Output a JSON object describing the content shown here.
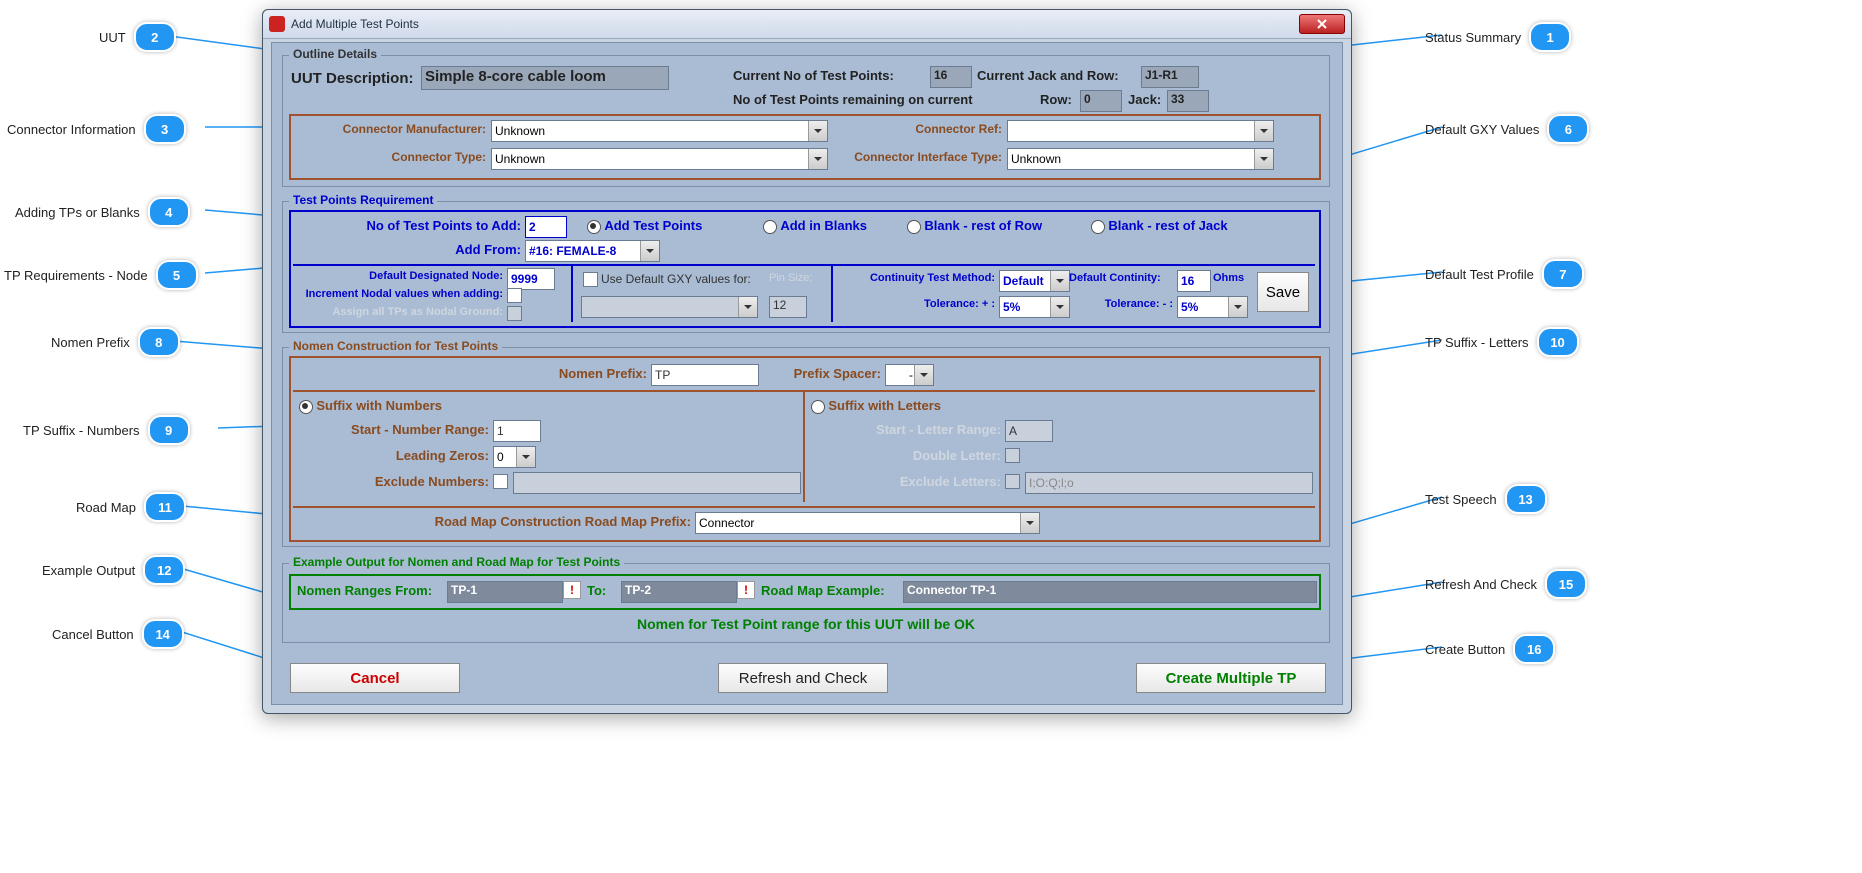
{
  "callouts": {
    "c1": {
      "n": "1",
      "label": "Status Summary"
    },
    "c2": {
      "n": "2",
      "label": "UUT"
    },
    "c3": {
      "n": "3",
      "label": "Connector Information"
    },
    "c4": {
      "n": "4",
      "label": "Adding TPs or Blanks"
    },
    "c5": {
      "n": "5",
      "label": "TP Requirements - Node"
    },
    "c6": {
      "n": "6",
      "label": "Default GXY Values"
    },
    "c7": {
      "n": "7",
      "label": "Default Test Profile"
    },
    "c8": {
      "n": "8",
      "label": "Nomen Prefix"
    },
    "c9": {
      "n": "9",
      "label": "TP Suffix - Numbers"
    },
    "c10": {
      "n": "10",
      "label": "TP Suffix - Letters"
    },
    "c11": {
      "n": "11",
      "label": "Road Map"
    },
    "c12": {
      "n": "12",
      "label": "Example Output"
    },
    "c13": {
      "n": "13",
      "label": "Test Speech"
    },
    "c14": {
      "n": "14",
      "label": "Cancel Button"
    },
    "c15": {
      "n": "15",
      "label": "Refresh And Check"
    },
    "c16": {
      "n": "16",
      "label": "Create Button"
    }
  },
  "window": {
    "title": "Add Multiple Test Points"
  },
  "outline": {
    "legend": "Outline Details",
    "uut_label": "UUT Description:",
    "uut_value": "Simple 8-core cable loom",
    "cur_tp_label": "Current No of Test Points:",
    "cur_tp_value": "16",
    "cur_jr_label": "Current Jack and Row:",
    "cur_jr_value": "J1-R1",
    "remain_label": "No of Test Points remaining on current",
    "row_label": "Row:",
    "row_value": "0",
    "jack_label": "Jack:",
    "jack_value": "33",
    "conn_mfr_label": "Connector Manufacturer:",
    "conn_mfr_value": "Unknown",
    "conn_ref_label": "Connector Ref:",
    "conn_ref_value": "",
    "conn_type_label": "Connector Type:",
    "conn_type_value": "Unknown",
    "conn_if_label": "Connector Interface Type:",
    "conn_if_value": "Unknown"
  },
  "tpreq": {
    "legend": "Test Points Requirement",
    "num_add_label": "No of Test Points to Add:",
    "num_add_value": "2",
    "add_from_label": "Add From:",
    "add_from_value": "#16: FEMALE-8",
    "r_add_tp": "Add Test Points",
    "r_add_blanks": "Add in Blanks",
    "r_blank_row": "Blank - rest of Row",
    "r_blank_jack": "Blank - rest of Jack",
    "def_node_label": "Default Designated Node:",
    "def_node_value": "9999",
    "inc_nodal_label": "Increment Nodal values when adding:",
    "assign_nodal_label": "Assign all TPs as Nodal Ground:",
    "use_gxy_label": "Use Default GXY values for:",
    "pin_size_label": "Pin Size:",
    "pin_size_value": "12",
    "cont_method_label": "Continuity Test Method:",
    "cont_method_value": "Default",
    "def_cont_label": "Default Continity:",
    "def_cont_value": "16",
    "ohms_label": "Ohms",
    "tol_plus_label": "Tolerance: + :",
    "tol_plus_value": "5%",
    "tol_minus_label": "Tolerance: - :",
    "tol_minus_value": "5%",
    "save_label": "Save"
  },
  "nomen": {
    "legend": "Nomen Construction for Test Points",
    "prefix_label": "Nomen Prefix:",
    "prefix_value": "TP",
    "spacer_label": "Prefix Spacer:",
    "spacer_value": "-",
    "suffix_num_label": "Suffix with Numbers",
    "start_num_label": "Start - Number Range:",
    "start_num_value": "1",
    "lz_label": "Leading Zeros:",
    "lz_value": "0",
    "excl_num_label": "Exclude Numbers:",
    "excl_num_value": "",
    "suffix_let_label": "Suffix with Letters",
    "start_let_label": "Start - Letter Range:",
    "start_let_value": "A",
    "dbl_let_label": "Double Letter:",
    "excl_let_label": "Exclude Letters:",
    "excl_let_value": "I;O:Q;l;o",
    "roadmap_label": "Road Map Construction Road Map Prefix:",
    "roadmap_value": "Connector"
  },
  "example": {
    "legend": "Example Output for Nomen and Road Map for Test Points",
    "ranges_from_label": "Nomen Ranges From:",
    "ranges_from_value": "TP-1",
    "to_label": "To:",
    "to_value": "TP-2",
    "rm_example_label": "Road Map Example:",
    "rm_example_value": "Connector  TP-1",
    "status_msg": "Nomen for Test Point range for this UUT will be OK"
  },
  "buttons": {
    "cancel": "Cancel",
    "refresh": "Refresh and Check",
    "create": "Create Multiple TP"
  }
}
